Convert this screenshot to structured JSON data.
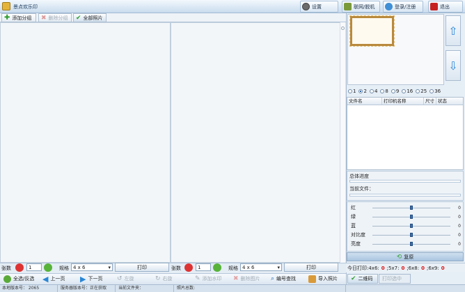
{
  "app": {
    "title": "景点欢乐印"
  },
  "titlebar": {
    "settings": "设置",
    "network": "联网/脱机",
    "login": "登录/注册",
    "exit": "退出"
  },
  "toolbar": {
    "add_group": "添加分组",
    "delete_group": "删除分组",
    "all_photos": "全部照片"
  },
  "print_controls": {
    "count_label": "张数",
    "count_value": "1",
    "spec_label": "规格",
    "spec_value": "4 x 6",
    "print": "打印"
  },
  "nav": {
    "select_all": "全选/反选",
    "prev_page": "上一页",
    "next_page": "下一页",
    "rotate_left": "左旋",
    "rotate_right": "右旋",
    "add_watermark": "添加水印",
    "delete_photo": "删除图片",
    "number_search": "编号查找",
    "import_photo": "导入照片"
  },
  "status": {
    "local_version": "本地版本号：  2065",
    "server_version": "服务器版本号：正在获取",
    "current_folder": "当前文件夹：",
    "total_photos": "照片总数:"
  },
  "layout_options": [
    "1",
    "2",
    "4",
    "8",
    "9",
    "16",
    "25",
    "36"
  ],
  "selected_layout": "2",
  "printer_table": {
    "columns": [
      "文件名",
      "打印机名称",
      "尺寸",
      "状态"
    ]
  },
  "progress": {
    "total_label": "总体进度",
    "current_file_label": "当前文件："
  },
  "adjustments": [
    {
      "label": "红",
      "value": "0"
    },
    {
      "label": "绿",
      "value": "0"
    },
    {
      "label": "蓝",
      "value": "0"
    },
    {
      "label": "对比度",
      "value": "0"
    },
    {
      "label": "亮度",
      "value": "0"
    }
  ],
  "restore": "复原",
  "today": {
    "label": "今日打印:4x6:",
    "v1": "0",
    "label2": ";5x7:",
    "v2": "0",
    "label3": ";6x8:",
    "v3": "0",
    "label4": ";6x9:",
    "v4": "0"
  },
  "right_tabs": {
    "qr": "二维码",
    "print_selected": "打印选中"
  },
  "colors": {
    "accent": "#2a6db3",
    "danger": "#d11111",
    "ok": "#3aa03a"
  }
}
